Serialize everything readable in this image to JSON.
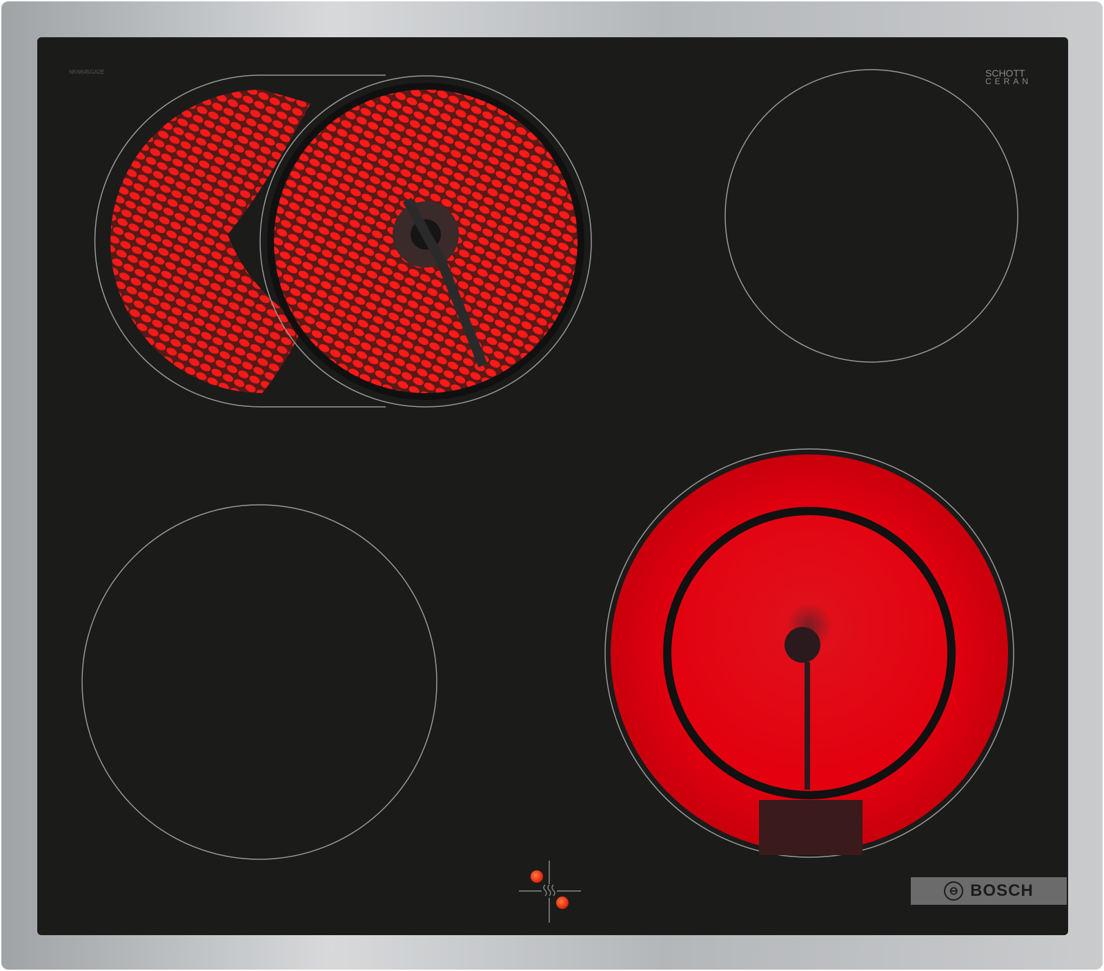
{
  "product": {
    "model_label": "NKN645GA2E",
    "glass_brand_line1": "SCHOTT",
    "glass_brand_line2": "CERAN",
    "brand_badge": "BOSCH",
    "brand_icon": "bosch-armature-icon"
  },
  "cooking_zones": [
    {
      "name": "front-left-extendable",
      "state": "on"
    },
    {
      "name": "back-right",
      "state": "off"
    },
    {
      "name": "back-left",
      "state": "off"
    },
    {
      "name": "front-right-dual",
      "state": "on"
    }
  ],
  "colors": {
    "glass": "#1b1b1a",
    "frame": "#b9bcbf",
    "heat": "#e3000f",
    "zone_outline": "#9a9a9a",
    "badge": "#6b6b6b"
  },
  "indicator": {
    "icon": "residual-heat-icon"
  }
}
